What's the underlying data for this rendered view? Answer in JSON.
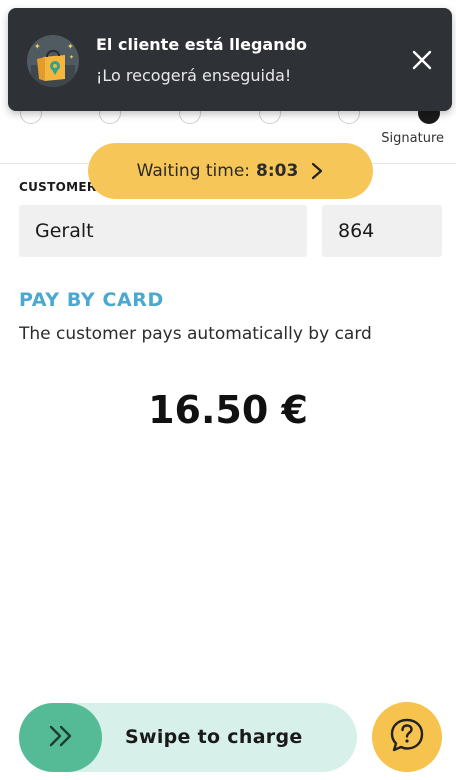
{
  "notification": {
    "title": "El cliente está llegando",
    "subtitle": "¡Lo recogerá enseguida!",
    "icon": "shopping-bag-pin-icon",
    "close_icon": "close-icon"
  },
  "steps": {
    "active_label": "Signature"
  },
  "waiting": {
    "label": "Waiting time:",
    "value": "8:03",
    "icon": "chevron-right-icon"
  },
  "customer": {
    "label": "CUSTOMER",
    "name": "Geralt",
    "number": "864"
  },
  "payment": {
    "title": "PAY BY CARD",
    "description": "The customer pays automatically by card",
    "amount": "16.50 €"
  },
  "swipe": {
    "label": "Swipe to charge",
    "icon": "double-chevron-right-icon"
  },
  "help": {
    "icon": "question-bubble-icon"
  },
  "colors": {
    "notification_bg": "#2e3236",
    "accent_yellow": "#f7c659",
    "pay_blue": "#4ba8d1",
    "swipe_bg": "#d7f1ea",
    "swipe_knob": "#55bb97"
  }
}
